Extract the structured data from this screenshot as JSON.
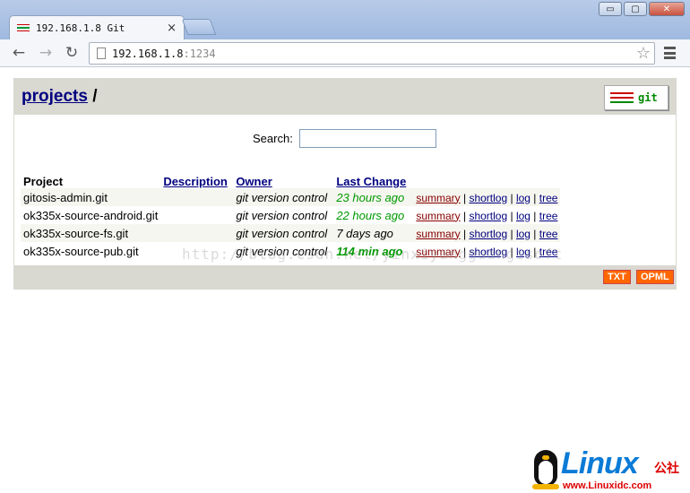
{
  "browser": {
    "tab_title": "192.168.1.8 Git",
    "tab_close": "×",
    "url_host": "192.168.1.8",
    "url_port": ":1234",
    "back_icon": "←",
    "forward_icon": "→",
    "reload_icon": "↻",
    "star_icon": "☆",
    "window": {
      "minimize": "▭",
      "maximize": "▢",
      "close": "✕"
    }
  },
  "gitweb": {
    "breadcrumb_link": "projects",
    "breadcrumb_sep": " /",
    "logo_text": "git",
    "search_label": "Search:",
    "search_value": "",
    "columns": {
      "project": "Project",
      "description": "Description",
      "owner": "Owner",
      "last_change": "Last Change"
    },
    "projects": [
      {
        "name": "gitosis-admin.git",
        "description": "",
        "owner": "git version control",
        "age": "23 hours ago",
        "age_class": "age1"
      },
      {
        "name": "ok335x-source-android.git",
        "description": "",
        "owner": "git version control",
        "age": "22 hours ago",
        "age_class": "age1"
      },
      {
        "name": "ok335x-source-fs.git",
        "description": "",
        "owner": "git version control",
        "age": "7 days ago",
        "age_class": "age2"
      },
      {
        "name": "ok335x-source-pub.git",
        "description": "",
        "owner": "git version control",
        "age": "114 min ago",
        "age_class": "age0"
      }
    ],
    "links": {
      "summary": "summary",
      "shortlog": "shortlog",
      "log": "log",
      "tree": "tree",
      "sep": " | "
    },
    "feeds": {
      "txt": "TXT",
      "opml": "OPML"
    },
    "colors": {
      "header_bg": "#d9d8d1",
      "link": "#000080",
      "summary_link": "#880000",
      "age_recent": "#009900",
      "feed": "#ff6600"
    }
  },
  "watermark": "http://blog.csdn.net/yinxiyangguangisoft",
  "corner_logo": {
    "word": "Linux",
    "cn": "公社",
    "url": "www.Linuxidc.com"
  }
}
